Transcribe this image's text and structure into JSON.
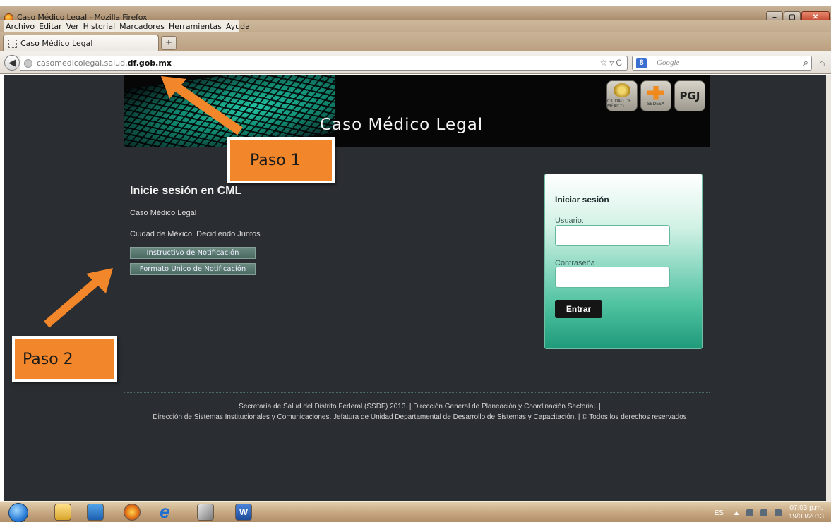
{
  "browser": {
    "window_title": "Caso Médico Legal - Mozilla Firefox",
    "menu": [
      "Archivo",
      "Editar",
      "Ver",
      "Historial",
      "Marcadores",
      "Herramientas",
      "Ayuda"
    ],
    "tab_title": "Caso Médico Legal",
    "new_tab": "+",
    "url_prefix": "casomedicolegal.salud.",
    "url_domain": "df.gob.mx",
    "search_engine": "Google",
    "search_placeholder": "Google"
  },
  "page": {
    "banner_title": "Caso Médico Legal",
    "logos": [
      {
        "name": "CIUDAD DE MÉXICO"
      },
      {
        "name": "SEDESA"
      },
      {
        "name": "PGJ"
      }
    ],
    "heading": "Inicie sesión en CML",
    "line1": "Caso Médico Legal",
    "line2": "Ciudad de México, Decidiendo Juntos",
    "doc_buttons": [
      "Instructivo de Notificación",
      "Formato Unico de Notificación"
    ],
    "login": {
      "title": "Iniciar sesión",
      "user_label": "Usuario:",
      "user_value": "",
      "pass_label": "Contraseña",
      "pass_value": "",
      "submit_label": "Entrar"
    },
    "footer_line1": "Secretaría de Salud del Distrito Federal (SSDF) 2013.  |  Dirección General de Planeación y Coordinación Sectorial.  |",
    "footer_line2": "Dirección de Sistemas Institucionales y Comunicaciones. Jefatura de Unidad Departamental de Desarrollo de Sistemas y Capacitación.  |  © Todos los derechos reservados"
  },
  "annotations": {
    "step1": "Paso 1",
    "step2": "Paso 2",
    "color": "#f2862a"
  },
  "taskbar": {
    "language": "ES",
    "time": "07:03 p.m.",
    "date": "19/03/2013"
  },
  "colors": {
    "page_bg": "#2a2d31",
    "accent": "#1f9a7a"
  }
}
